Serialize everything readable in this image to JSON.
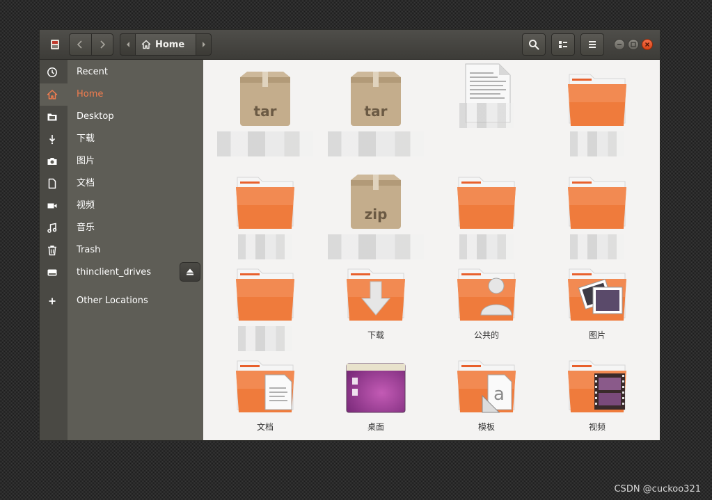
{
  "header": {
    "path_home_label": "Home"
  },
  "sidebar": {
    "items": [
      {
        "label": "Recent",
        "icon": "clock-icon"
      },
      {
        "label": "Home",
        "icon": "home-icon",
        "active": true
      },
      {
        "label": "Desktop",
        "icon": "desktop-icon"
      },
      {
        "label": "下载",
        "icon": "download-icon"
      },
      {
        "label": "图片",
        "icon": "camera-icon"
      },
      {
        "label": "文档",
        "icon": "document-icon"
      },
      {
        "label": "视频",
        "icon": "video-icon"
      },
      {
        "label": "音乐",
        "icon": "music-icon"
      },
      {
        "label": "Trash",
        "icon": "trash-icon"
      },
      {
        "label": "thinclient_drives",
        "icon": "drive-icon"
      },
      {
        "label": "Other Locations",
        "icon": "plus-icon"
      }
    ]
  },
  "files": [
    {
      "name": "",
      "type": "archive",
      "badge": "tar"
    },
    {
      "name": "",
      "type": "archive",
      "badge": "tar"
    },
    {
      "name": "",
      "type": "text-file"
    },
    {
      "name": "",
      "type": "folder"
    },
    {
      "name": "",
      "type": "folder"
    },
    {
      "name": "",
      "type": "archive",
      "badge": "zip"
    },
    {
      "name": "",
      "type": "folder"
    },
    {
      "name": "",
      "type": "folder"
    },
    {
      "name": "",
      "type": "folder"
    },
    {
      "name": "下载",
      "type": "folder-download"
    },
    {
      "name": "公共的",
      "type": "folder-public"
    },
    {
      "name": "图片",
      "type": "folder-pictures"
    },
    {
      "name": "文档",
      "type": "folder-documents"
    },
    {
      "name": "桌面",
      "type": "folder-desktop"
    },
    {
      "name": "模板",
      "type": "folder-templates"
    },
    {
      "name": "视频",
      "type": "folder-videos"
    }
  ],
  "watermark": "CSDN @cuckoo321",
  "colors": {
    "accent": "#f27d4f",
    "folder_orange": "#e8602c",
    "sidebar_bg": "#5e5d56",
    "headerbar_bg": "#45443f"
  }
}
